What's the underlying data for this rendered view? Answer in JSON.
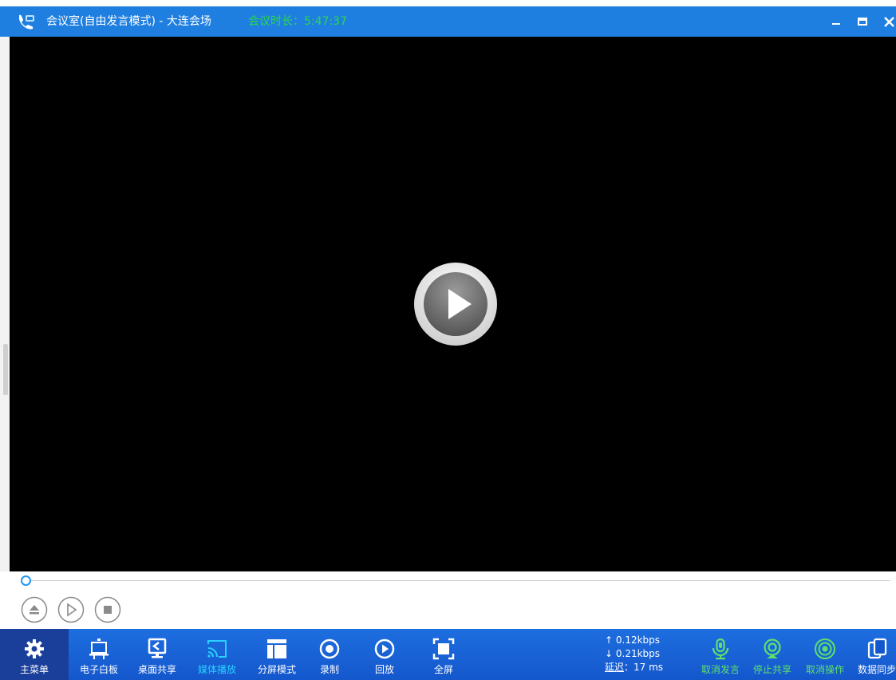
{
  "window": {
    "title": "会议室(自由发言模式) - 大连会场",
    "duration_label": "会议时长：",
    "duration_value": "5:47:37"
  },
  "colors": {
    "titlebar": "#1f7fe0",
    "toolbar": "#1457cc",
    "accent_green": "#29d84a",
    "accent_cyan": "#29d0ff",
    "progress": "#2196f3"
  },
  "player": {
    "progress_fraction": 0.0
  },
  "toolbar": {
    "main_menu": "主菜单",
    "whiteboard": "电子白板",
    "desktop_share": "桌面共享",
    "media_play": "媒体播放",
    "split_mode": "分屏模式",
    "record": "录制",
    "playback": "回放",
    "fullscreen": "全屏",
    "cancel_speak": "取消发言",
    "stop_share": "停止共享",
    "cancel_operation": "取消操作",
    "data_sync": "数据同步"
  },
  "network": {
    "upload": "↑ 0.12kbps",
    "download": "↓ 0.21kbps",
    "latency_label": "延迟",
    "latency_value": "：17 ms"
  },
  "icons": {
    "app": "conference-logo-icon",
    "minimize": "minimize-icon",
    "maximize": "maximize-icon",
    "close": "close-icon"
  }
}
